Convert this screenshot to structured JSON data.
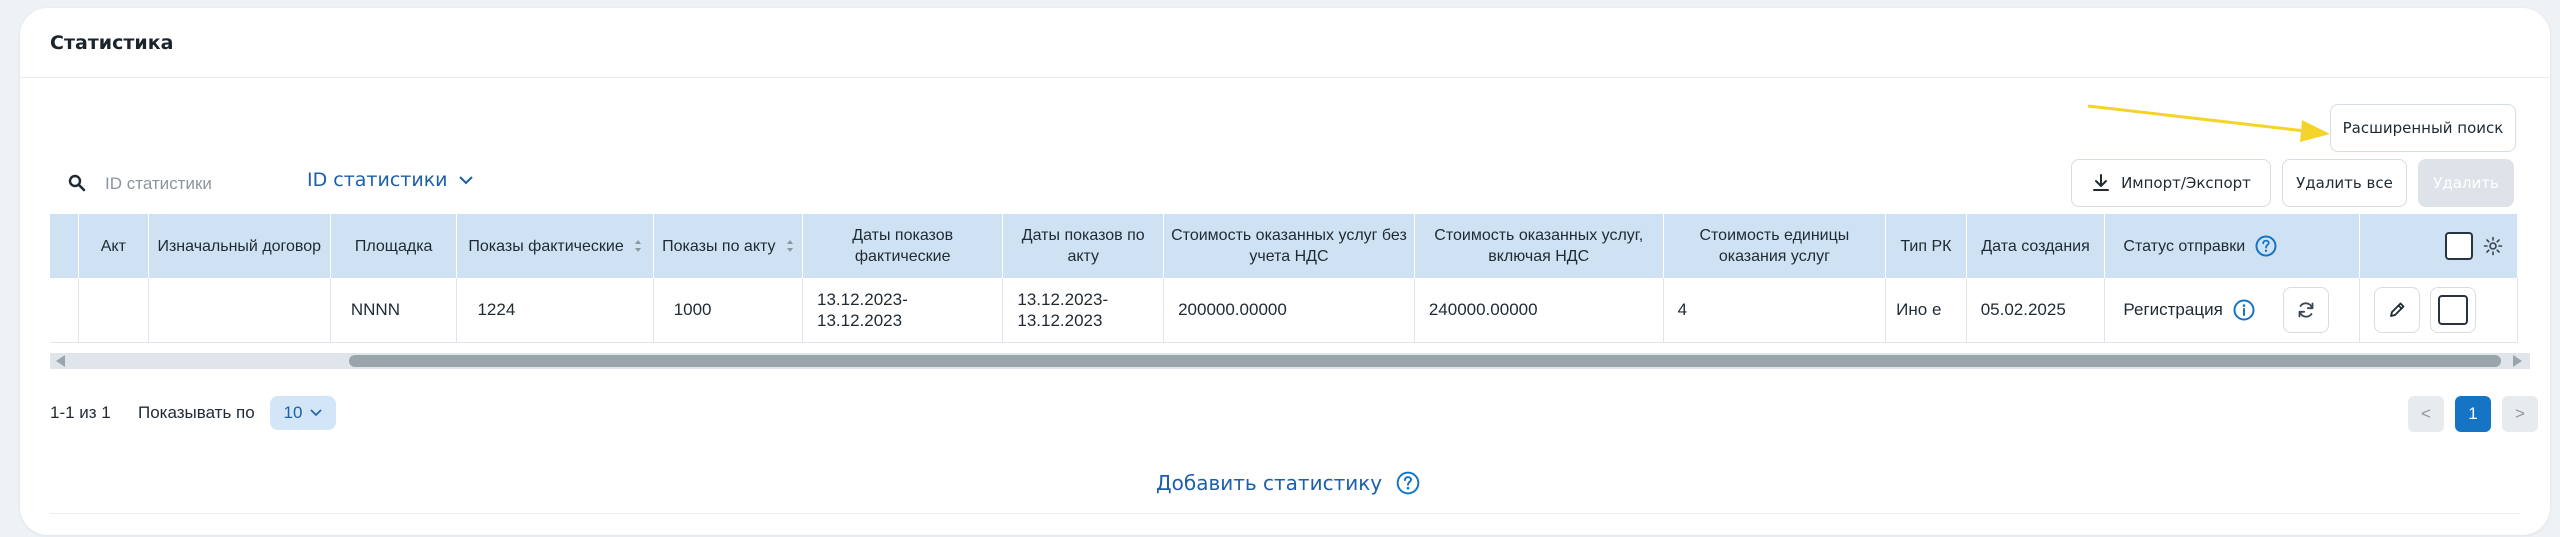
{
  "header": {
    "title": "Статистика"
  },
  "toolbar": {
    "advanced_search": "Расширенный поиск",
    "import_export": "Импорт/Экспорт",
    "delete_all": "Удалить все",
    "delete": "Удалить"
  },
  "search": {
    "placeholder": "ID статистики",
    "field_select": "ID статистики"
  },
  "table": {
    "headers": {
      "act": "Акт",
      "contract": "Изначальный договор",
      "platform": "Площадка",
      "shows_actual": "Показы фактические",
      "shows_act": "Показы по акту",
      "dates_actual": "Даты показов фактические",
      "dates_act": "Даты показов по акту",
      "cost_no_vat": "Стоимость оказанных услуг без учета НДС",
      "cost_vat": "Стоимость оказанных услуг, включая НДС",
      "unit_cost": "Стоимость единицы оказания услуг",
      "rk_type": "Тип РК",
      "created": "Дата создания",
      "send_status": "Статус отправки"
    },
    "row": {
      "act": "",
      "contract": "",
      "platform": "NNNN",
      "shows_actual": "1224",
      "shows_act": "1000",
      "dates_actual": "13.12.2023-13.12.2023",
      "dates_act": "13.12.2023-13.12.2023",
      "cost_no_vat": "200000.00000",
      "cost_vat": "240000.00000",
      "unit_cost": "4",
      "rk_type": "Ино е",
      "created": "05.02.2025",
      "send_status": "Регистрация"
    }
  },
  "pagination": {
    "count": "1-1 из 1",
    "per_page_label": "Показывать по",
    "per_page": "10",
    "current": "1",
    "prev": "<",
    "next": ">"
  },
  "add_statistics": "Добавить статистику",
  "colors": {
    "accent": "#1574c4",
    "header_bg": "#cfe2f3",
    "arrow": "#f5d42a"
  },
  "icons": [
    "search-icon",
    "chevron-down-icon",
    "download-icon",
    "sort-icon",
    "info-icon",
    "refresh-icon",
    "pencil-icon",
    "gear-icon",
    "help-icon"
  ]
}
